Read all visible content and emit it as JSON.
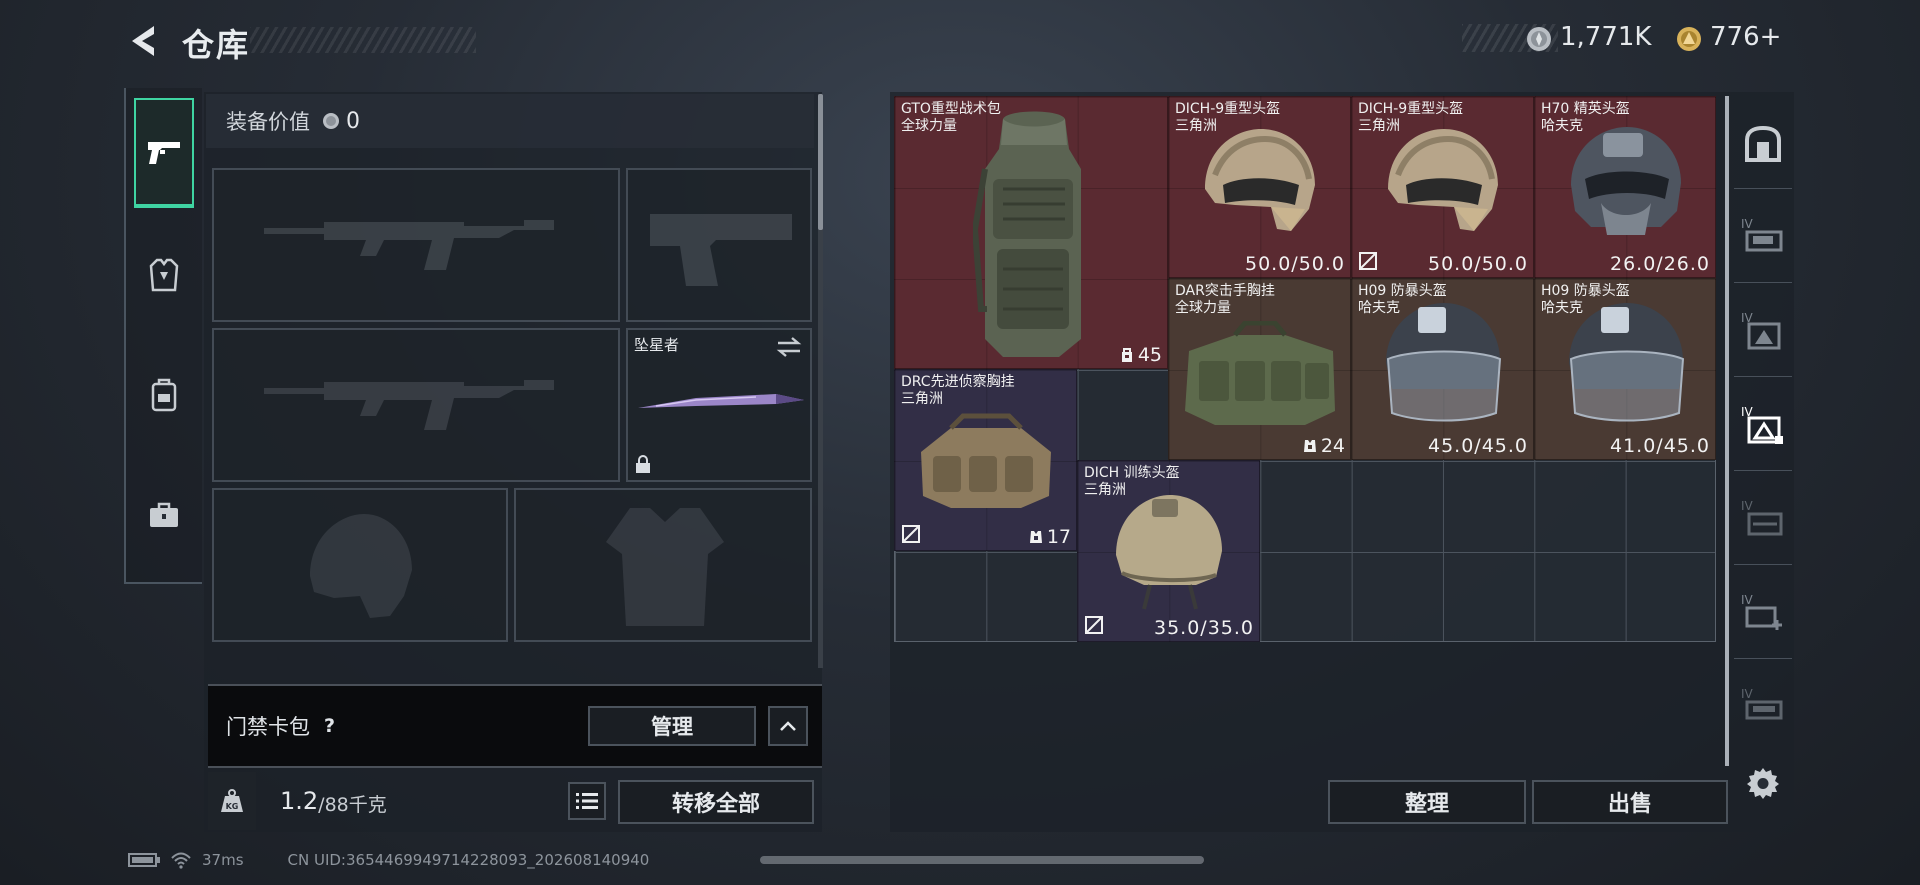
{
  "header": {
    "title": "仓库"
  },
  "currency": {
    "silver": "1,771K",
    "gold": "776+"
  },
  "left_tabs": [
    {
      "icon": "pistol-icon",
      "active": true
    },
    {
      "icon": "armor-vest-icon",
      "active": false
    },
    {
      "icon": "backpack-icon",
      "active": false
    },
    {
      "icon": "briefcase-icon",
      "active": false
    }
  ],
  "equipment": {
    "value_label": "装备价值",
    "value": "0",
    "melee_name": "坠星者"
  },
  "card_pack": {
    "label": "门禁卡包",
    "help": "?",
    "manage_label": "管理"
  },
  "weight": {
    "current": "1.2",
    "max": "/88千克",
    "transfer_label": "转移全部"
  },
  "items": [
    {
      "name": "GTO重型战术包",
      "sub": "全球力量",
      "value": "45",
      "kind": "capacity"
    },
    {
      "name": "DICH-9重型头盔",
      "sub": "三角洲",
      "value": "50.0/50.0",
      "kind": "durability"
    },
    {
      "name": "DICH-9重型头盔",
      "sub": "三角洲",
      "value": "50.0/50.0",
      "kind": "durability"
    },
    {
      "name": "H70 精英头盔",
      "sub": "哈夫克",
      "value": "26.0/26.0",
      "kind": "durability"
    },
    {
      "name": "DAR突击手胸挂",
      "sub": "全球力量",
      "value": "24",
      "kind": "capacity"
    },
    {
      "name": "H09 防暴头盔",
      "sub": "哈夫克",
      "value": "45.0/45.0",
      "kind": "durability"
    },
    {
      "name": "H09 防暴头盔",
      "sub": "哈夫克",
      "value": "41.0/45.0",
      "kind": "durability"
    },
    {
      "name": "DRC先进侦察胸挂",
      "sub": "三角洲",
      "value": "17",
      "kind": "capacity"
    },
    {
      "name": "DICH 训练头盔",
      "sub": "三角洲",
      "value": "35.0/35.0",
      "kind": "durability"
    }
  ],
  "right_nav": [
    {
      "icon": "safe-box-icon",
      "level": ""
    },
    {
      "icon": "storage-shelf-icon",
      "level": "IV"
    },
    {
      "icon": "storage-crate-icon",
      "level": "IV"
    },
    {
      "icon": "storage-selected-icon",
      "level": "IV"
    },
    {
      "icon": "storage-cabinet-icon",
      "level": "IV"
    },
    {
      "icon": "storage-add-icon",
      "level": "IV"
    },
    {
      "icon": "storage-rack-icon",
      "level": "IV"
    }
  ],
  "actions": {
    "sort_label": "整理",
    "sell_label": "出售"
  },
  "status": {
    "ping": "37ms",
    "uid": "CN UID:3654469949714228093_202608140940"
  },
  "colors": {
    "accent": "#3fd4a2",
    "rarity_red": "#5a2a31",
    "rarity_brown": "#4a3a33",
    "rarity_purple": "#322e46"
  }
}
